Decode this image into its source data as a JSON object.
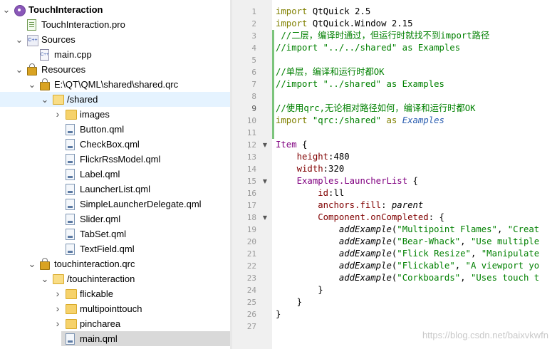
{
  "tree": [
    {
      "label": "TouchInteraction",
      "indent": 0,
      "arrow": "open",
      "icon": "gear",
      "bold": true
    },
    {
      "label": "TouchInteraction.pro",
      "indent": 1,
      "arrow": "",
      "icon": "pro"
    },
    {
      "label": "Sources",
      "indent": 1,
      "arrow": "open",
      "icon": "src"
    },
    {
      "label": "main.cpp",
      "indent": 2,
      "arrow": "",
      "icon": "cpp"
    },
    {
      "label": "Resources",
      "indent": 1,
      "arrow": "open",
      "icon": "lock"
    },
    {
      "label": "E:\\QT\\QML\\shared\\shared.qrc",
      "indent": 2,
      "arrow": "open",
      "icon": "lock"
    },
    {
      "label": "/shared",
      "indent": 3,
      "arrow": "open",
      "icon": "folder",
      "state": "sel"
    },
    {
      "label": "images",
      "indent": 4,
      "arrow": "closed",
      "icon": "folder"
    },
    {
      "label": "Button.qml",
      "indent": 4,
      "arrow": "",
      "icon": "qml"
    },
    {
      "label": "CheckBox.qml",
      "indent": 4,
      "arrow": "",
      "icon": "qml"
    },
    {
      "label": "FlickrRssModel.qml",
      "indent": 4,
      "arrow": "",
      "icon": "qml"
    },
    {
      "label": "Label.qml",
      "indent": 4,
      "arrow": "",
      "icon": "qml"
    },
    {
      "label": "LauncherList.qml",
      "indent": 4,
      "arrow": "",
      "icon": "qml"
    },
    {
      "label": "SimpleLauncherDelegate.qml",
      "indent": 4,
      "arrow": "",
      "icon": "qml"
    },
    {
      "label": "Slider.qml",
      "indent": 4,
      "arrow": "",
      "icon": "qml"
    },
    {
      "label": "TabSet.qml",
      "indent": 4,
      "arrow": "",
      "icon": "qml"
    },
    {
      "label": "TextField.qml",
      "indent": 4,
      "arrow": "",
      "icon": "qml"
    },
    {
      "label": "touchinteraction.qrc",
      "indent": 2,
      "arrow": "open",
      "icon": "lock"
    },
    {
      "label": "/touchinteraction",
      "indent": 3,
      "arrow": "open",
      "icon": "folder"
    },
    {
      "label": "flickable",
      "indent": 4,
      "arrow": "closed",
      "icon": "folder"
    },
    {
      "label": "multipointtouch",
      "indent": 4,
      "arrow": "closed",
      "icon": "folder"
    },
    {
      "label": "pincharea",
      "indent": 4,
      "arrow": "closed",
      "icon": "folder"
    },
    {
      "label": "main.qml",
      "indent": 4,
      "arrow": "",
      "icon": "qml",
      "state": "hl"
    }
  ],
  "editor": {
    "lines": [
      {
        "n": "1",
        "segs": [
          {
            "t": "import ",
            "c": "kw"
          },
          {
            "t": "QtQuick 2.5",
            "c": ""
          }
        ]
      },
      {
        "n": "2",
        "segs": [
          {
            "t": "import ",
            "c": "kw"
          },
          {
            "t": "QtQuick.Window 2.15",
            "c": ""
          }
        ]
      },
      {
        "n": "3",
        "segs": [
          {
            "t": " //二层，编译时通过，但运行时就找不到import路径",
            "c": "cm"
          }
        ]
      },
      {
        "n": "4",
        "segs": [
          {
            "t": "//import \"../../shared\" as Examples",
            "c": "cm"
          }
        ]
      },
      {
        "n": "5",
        "segs": []
      },
      {
        "n": "6",
        "segs": [
          {
            "t": "//单层，编译和运行时都OK",
            "c": "cm"
          }
        ]
      },
      {
        "n": "7",
        "segs": [
          {
            "t": "//import \"../shared\" as Examples",
            "c": "cm"
          }
        ]
      },
      {
        "n": "8",
        "segs": []
      },
      {
        "n": "9",
        "segs": [
          {
            "t": "//使用qrc,无论相对路径如何，编译和运行时都OK",
            "c": "cm"
          }
        ],
        "cur": true
      },
      {
        "n": "10",
        "segs": [
          {
            "t": "import ",
            "c": "kw"
          },
          {
            "t": "\"qrc:/shared\"",
            "c": "str"
          },
          {
            "t": " as ",
            "c": "kw"
          },
          {
            "t": "Examples",
            "c": "blue"
          }
        ]
      },
      {
        "n": "11",
        "segs": []
      },
      {
        "n": "12",
        "fold": true,
        "segs": [
          {
            "t": "Item",
            "c": "typ"
          },
          {
            "t": " {",
            "c": ""
          }
        ]
      },
      {
        "n": "13",
        "segs": [
          {
            "t": "    ",
            "c": ""
          },
          {
            "t": "height",
            "c": "prop"
          },
          {
            "t": ":480",
            "c": ""
          }
        ]
      },
      {
        "n": "14",
        "segs": [
          {
            "t": "    ",
            "c": ""
          },
          {
            "t": "width",
            "c": "prop"
          },
          {
            "t": ":320",
            "c": ""
          }
        ]
      },
      {
        "n": "15",
        "fold": true,
        "segs": [
          {
            "t": "    ",
            "c": ""
          },
          {
            "t": "Examples.LauncherList",
            "c": "typ"
          },
          {
            "t": " {",
            "c": ""
          }
        ]
      },
      {
        "n": "16",
        "segs": [
          {
            "t": "        ",
            "c": ""
          },
          {
            "t": "id",
            "c": "prop"
          },
          {
            "t": ":ll",
            "c": ""
          }
        ]
      },
      {
        "n": "17",
        "segs": [
          {
            "t": "        ",
            "c": ""
          },
          {
            "t": "anchors.fill",
            "c": "prop"
          },
          {
            "t": ": ",
            "c": ""
          },
          {
            "t": "parent",
            "c": "it"
          }
        ]
      },
      {
        "n": "18",
        "fold": true,
        "segs": [
          {
            "t": "        ",
            "c": ""
          },
          {
            "t": "Component.onCompleted",
            "c": "prop"
          },
          {
            "t": ": {",
            "c": ""
          }
        ]
      },
      {
        "n": "19",
        "segs": [
          {
            "t": "            ",
            "c": ""
          },
          {
            "t": "addExample",
            "c": "it"
          },
          {
            "t": "(",
            "c": ""
          },
          {
            "t": "\"Multipoint Flames\"",
            "c": "str"
          },
          {
            "t": ", ",
            "c": ""
          },
          {
            "t": "\"Creat",
            "c": "str"
          }
        ]
      },
      {
        "n": "20",
        "segs": [
          {
            "t": "            ",
            "c": ""
          },
          {
            "t": "addExample",
            "c": "it"
          },
          {
            "t": "(",
            "c": ""
          },
          {
            "t": "\"Bear-Whack\"",
            "c": "str"
          },
          {
            "t": ", ",
            "c": ""
          },
          {
            "t": "\"Use multiple",
            "c": "str"
          }
        ]
      },
      {
        "n": "21",
        "segs": [
          {
            "t": "            ",
            "c": ""
          },
          {
            "t": "addExample",
            "c": "it"
          },
          {
            "t": "(",
            "c": ""
          },
          {
            "t": "\"Flick Resize\"",
            "c": "str"
          },
          {
            "t": ", ",
            "c": ""
          },
          {
            "t": "\"Manipulate",
            "c": "str"
          }
        ]
      },
      {
        "n": "22",
        "segs": [
          {
            "t": "            ",
            "c": ""
          },
          {
            "t": "addExample",
            "c": "it"
          },
          {
            "t": "(",
            "c": ""
          },
          {
            "t": "\"Flickable\"",
            "c": "str"
          },
          {
            "t": ", ",
            "c": ""
          },
          {
            "t": "\"A viewport yo",
            "c": "str"
          }
        ]
      },
      {
        "n": "23",
        "segs": [
          {
            "t": "            ",
            "c": ""
          },
          {
            "t": "addExample",
            "c": "it"
          },
          {
            "t": "(",
            "c": ""
          },
          {
            "t": "\"Corkboards\"",
            "c": "str"
          },
          {
            "t": ", ",
            "c": ""
          },
          {
            "t": "\"Uses touch t",
            "c": "str"
          }
        ]
      },
      {
        "n": "24",
        "segs": [
          {
            "t": "        }",
            "c": ""
          }
        ]
      },
      {
        "n": "25",
        "segs": [
          {
            "t": "    }",
            "c": ""
          }
        ]
      },
      {
        "n": "26",
        "segs": [
          {
            "t": "}",
            "c": ""
          }
        ]
      },
      {
        "n": "27",
        "segs": []
      }
    ]
  },
  "watermark": "https://blog.csdn.net/baixvkwfn"
}
